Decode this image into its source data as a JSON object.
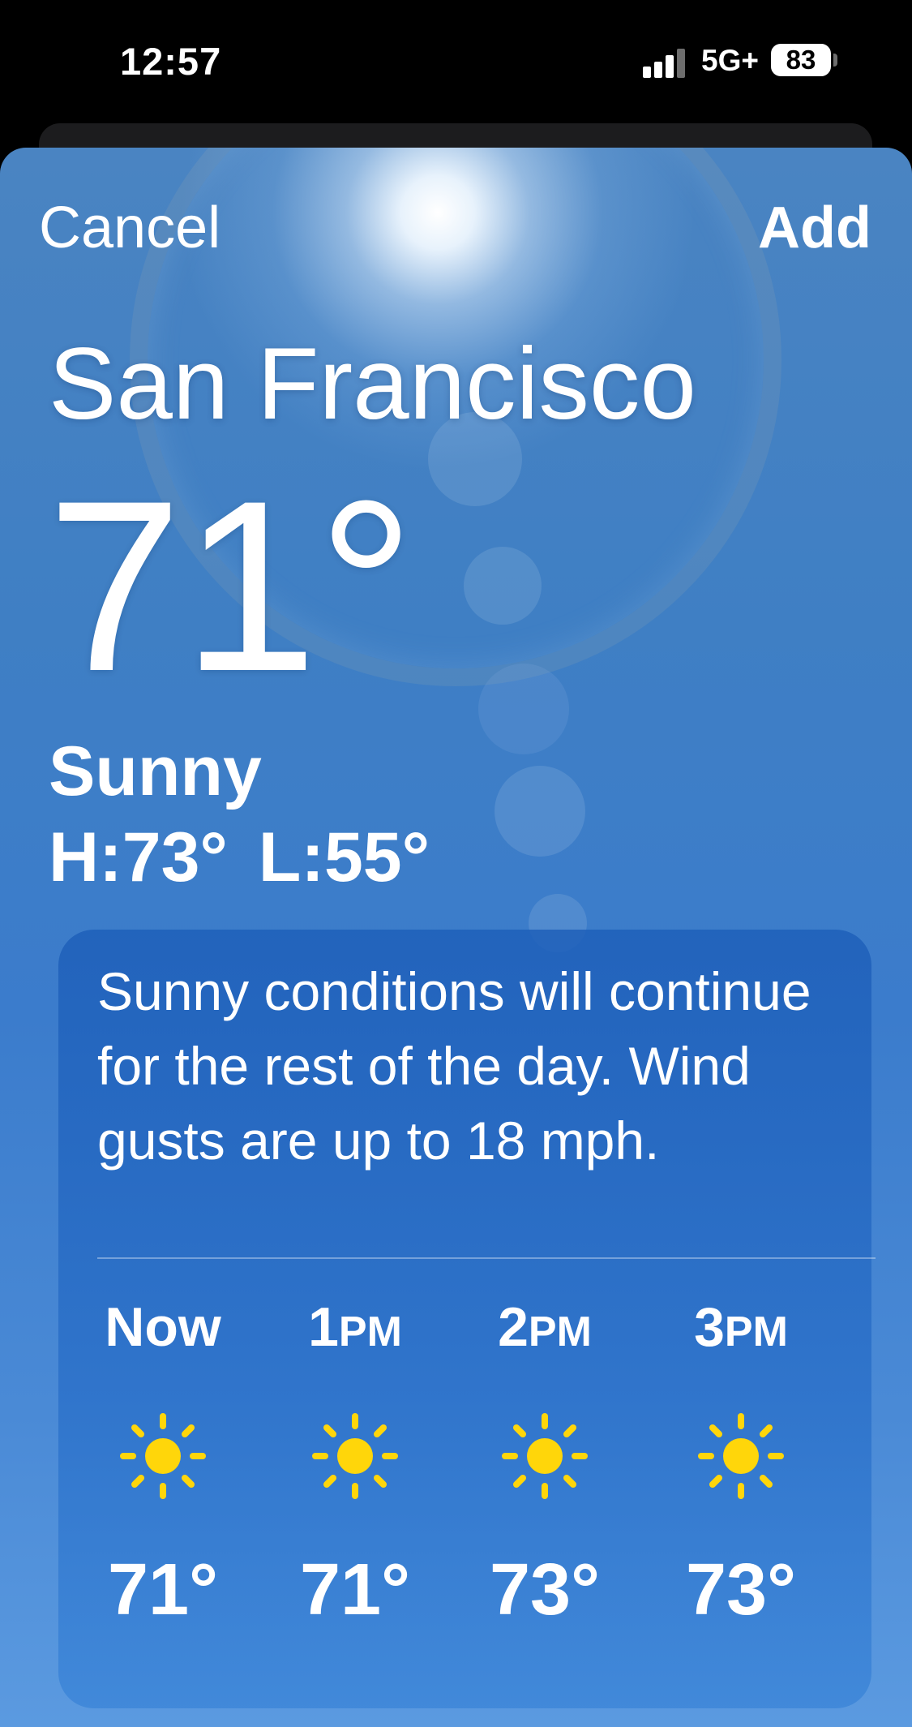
{
  "status_bar": {
    "time": "12:57",
    "network": "5G+",
    "battery": "83"
  },
  "nav": {
    "cancel_label": "Cancel",
    "add_label": "Add"
  },
  "weather": {
    "city": "San Francisco",
    "temperature": "71°",
    "condition": "Sunny",
    "high": "H:73°",
    "low": "L:55°"
  },
  "forecast": {
    "summary": "Sunny conditions will continue for the rest of the day. Wind gusts are up to 18 mph.",
    "hours": [
      {
        "hour": "Now",
        "ampm": "",
        "icon": "sun-icon",
        "temp": "71°"
      },
      {
        "hour": "1",
        "ampm": "PM",
        "icon": "sun-icon",
        "temp": "71°"
      },
      {
        "hour": "2",
        "ampm": "PM",
        "icon": "sun-icon",
        "temp": "73°"
      },
      {
        "hour": "3",
        "ampm": "PM",
        "icon": "sun-icon",
        "temp": "73°"
      }
    ]
  },
  "colors": {
    "sun": "#FFD60A",
    "sky_top": "#4A84C2",
    "sky_bottom": "#5B9AE0"
  }
}
